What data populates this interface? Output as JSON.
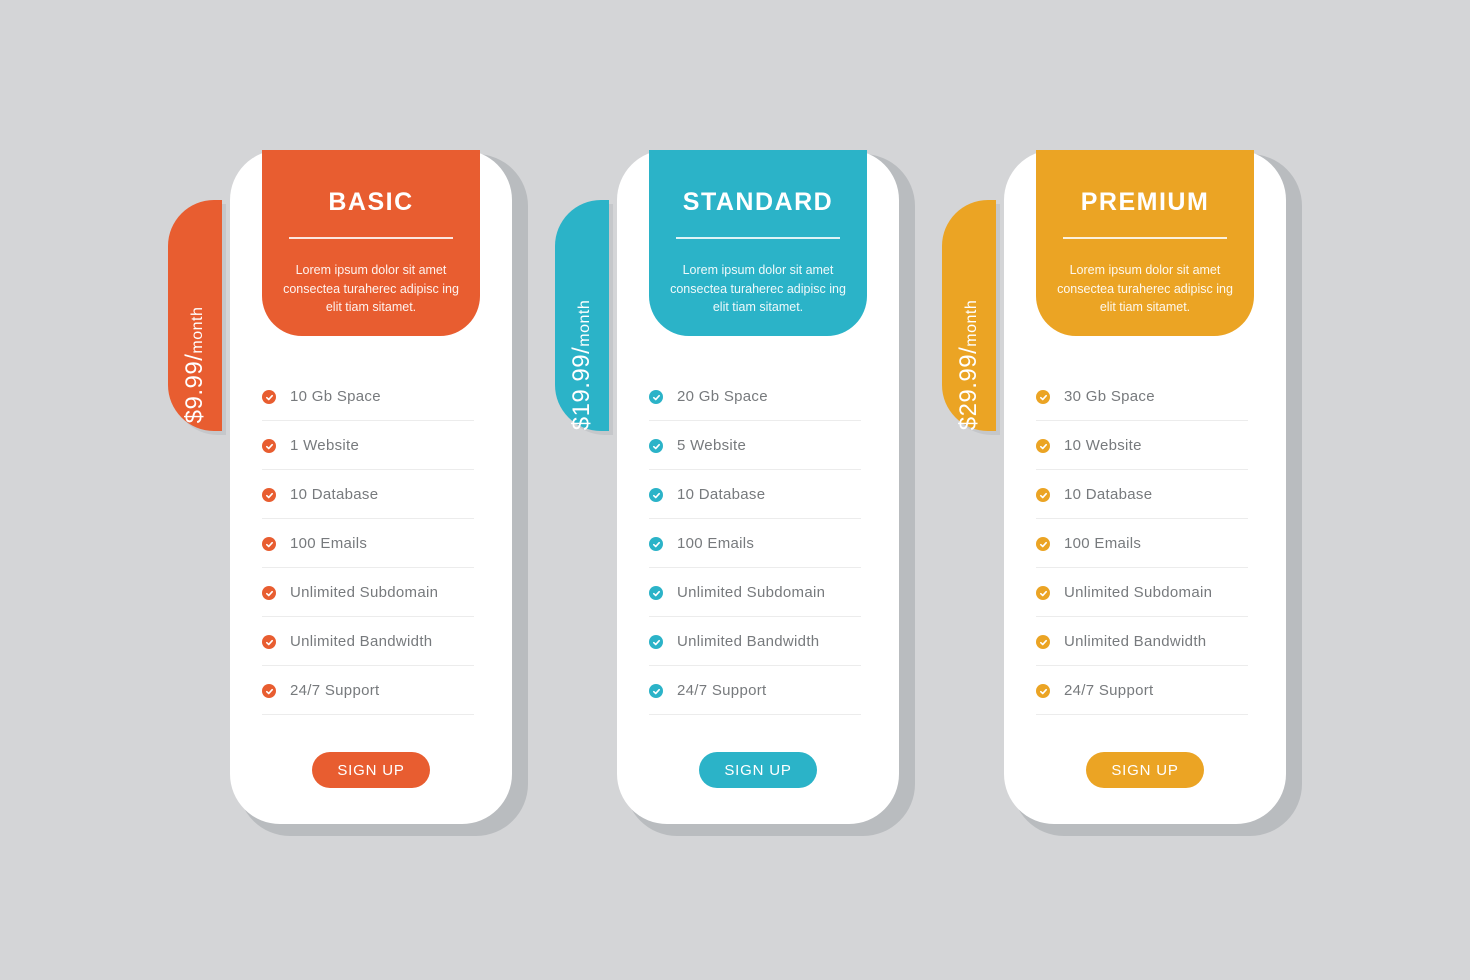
{
  "plans": [
    {
      "id": "basic",
      "name": "BASIC",
      "color": "#e85d30",
      "price_amount": "$9.99/",
      "price_period": "month",
      "description": "Lorem ipsum dolor sit amet consectea turaherec adipisc ing elit tiam sitamet.",
      "features": [
        "10 Gb Space",
        "1 Website",
        "10 Database",
        "100 Emails",
        "Unlimited Subdomain",
        "Unlimited Bandwidth",
        "24/7 Support"
      ],
      "feature_icon": "check-circle-icon",
      "button_label": "SIGN UP"
    },
    {
      "id": "standard",
      "name": "STANDARD",
      "color": "#2bb3c8",
      "price_amount": "$19.99/",
      "price_period": "month",
      "description": "Lorem ipsum dolor sit amet consectea turaherec adipisc ing elit tiam sitamet.",
      "features": [
        "20 Gb Space",
        "5 Website",
        "10 Database",
        "100 Emails",
        "Unlimited Subdomain",
        "Unlimited Bandwidth",
        "24/7 Support"
      ],
      "feature_icon": "check-circle-icon",
      "button_label": "SIGN UP"
    },
    {
      "id": "premium",
      "name": "PREMIUM",
      "color": "#eba424",
      "price_amount": "$29.99/",
      "price_period": "month",
      "description": "Lorem ipsum dolor sit amet consectea turaherec adipisc ing elit tiam sitamet.",
      "features": [
        "30 Gb Space",
        "10 Website",
        "10 Database",
        "100 Emails",
        "Unlimited Subdomain",
        "Unlimited Bandwidth",
        "24/7 Support"
      ],
      "feature_icon": "check-circle-icon",
      "button_label": "SIGN UP"
    }
  ]
}
